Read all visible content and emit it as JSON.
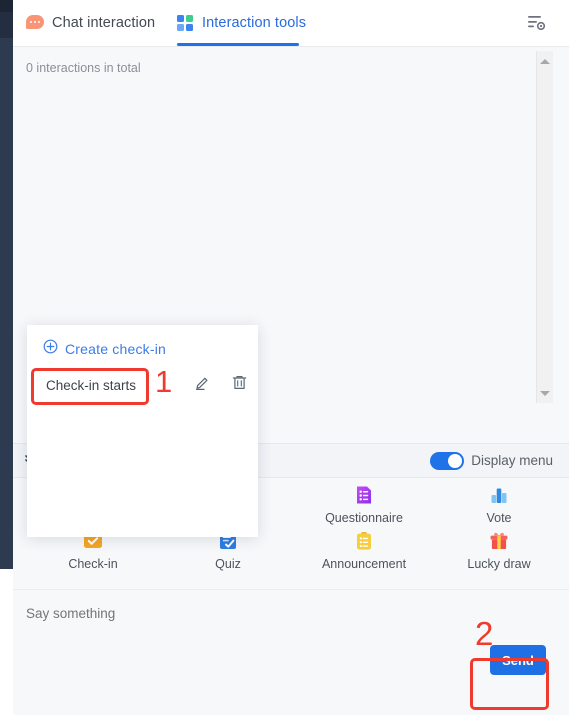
{
  "window": {
    "left_rail_color": "#2d3a50",
    "background": "#f7f8fa"
  },
  "header": {
    "tabs": [
      {
        "id": "chat-interaction",
        "label": "Chat interaction",
        "icon": "chat-bubble-icon",
        "active": false
      },
      {
        "id": "interaction-tools",
        "label": "Interaction tools",
        "icon": "grid-squares-icon",
        "active": true
      }
    ],
    "active_tab_color": "#2a6bdc",
    "underline_color": "#1f72e8",
    "settings_icon": "settings-lines-gear-icon"
  },
  "content": {
    "interaction_count_text": "0 interactions in total",
    "scrollbar": {
      "up_arrow": "scroll-up-arrow",
      "down_arrow": "scroll-down-arrow"
    }
  },
  "popup": {
    "create_label": "Create check-in",
    "create_icon": "plus-circle-icon",
    "item_label": "Check-in starts",
    "edit_icon": "pencil-edit-icon",
    "delete_icon": "trash-delete-icon"
  },
  "midbar": {
    "collapse_icon": "double-chevron-down-icon",
    "toggle_label": "Display menu",
    "toggle_on": true,
    "toggle_color": "#1f72e8"
  },
  "tools": [
    {
      "id": "check-in",
      "label": "Check-in",
      "icon": "checkmark-square-icon",
      "color": "#f5a623"
    },
    {
      "id": "quiz",
      "label": "Quiz",
      "icon": "quiz-document-icon",
      "color": "#2f7de1"
    },
    {
      "id": "questionnaire",
      "label": "Questionnaire",
      "icon": "questionnaire-form-icon",
      "color": "#a23df0"
    },
    {
      "id": "vote",
      "label": "Vote",
      "icon": "bar-chart-vote-icon",
      "color": "#4aa8f0"
    },
    {
      "id": "announcement",
      "label": "Announcement",
      "icon": "clipboard-announce-icon",
      "color": "#f5cd3f"
    },
    {
      "id": "lucky-draw",
      "label": "Lucky draw",
      "icon": "gift-box-icon",
      "color": "#f2504b"
    }
  ],
  "composer": {
    "input_value": "",
    "input_placeholder": "Say something",
    "send_label": "Send",
    "send_color": "#1f6fe5"
  },
  "annotations": {
    "step_one": "1",
    "step_two": "2",
    "highlight_color": "#f03a2e"
  }
}
